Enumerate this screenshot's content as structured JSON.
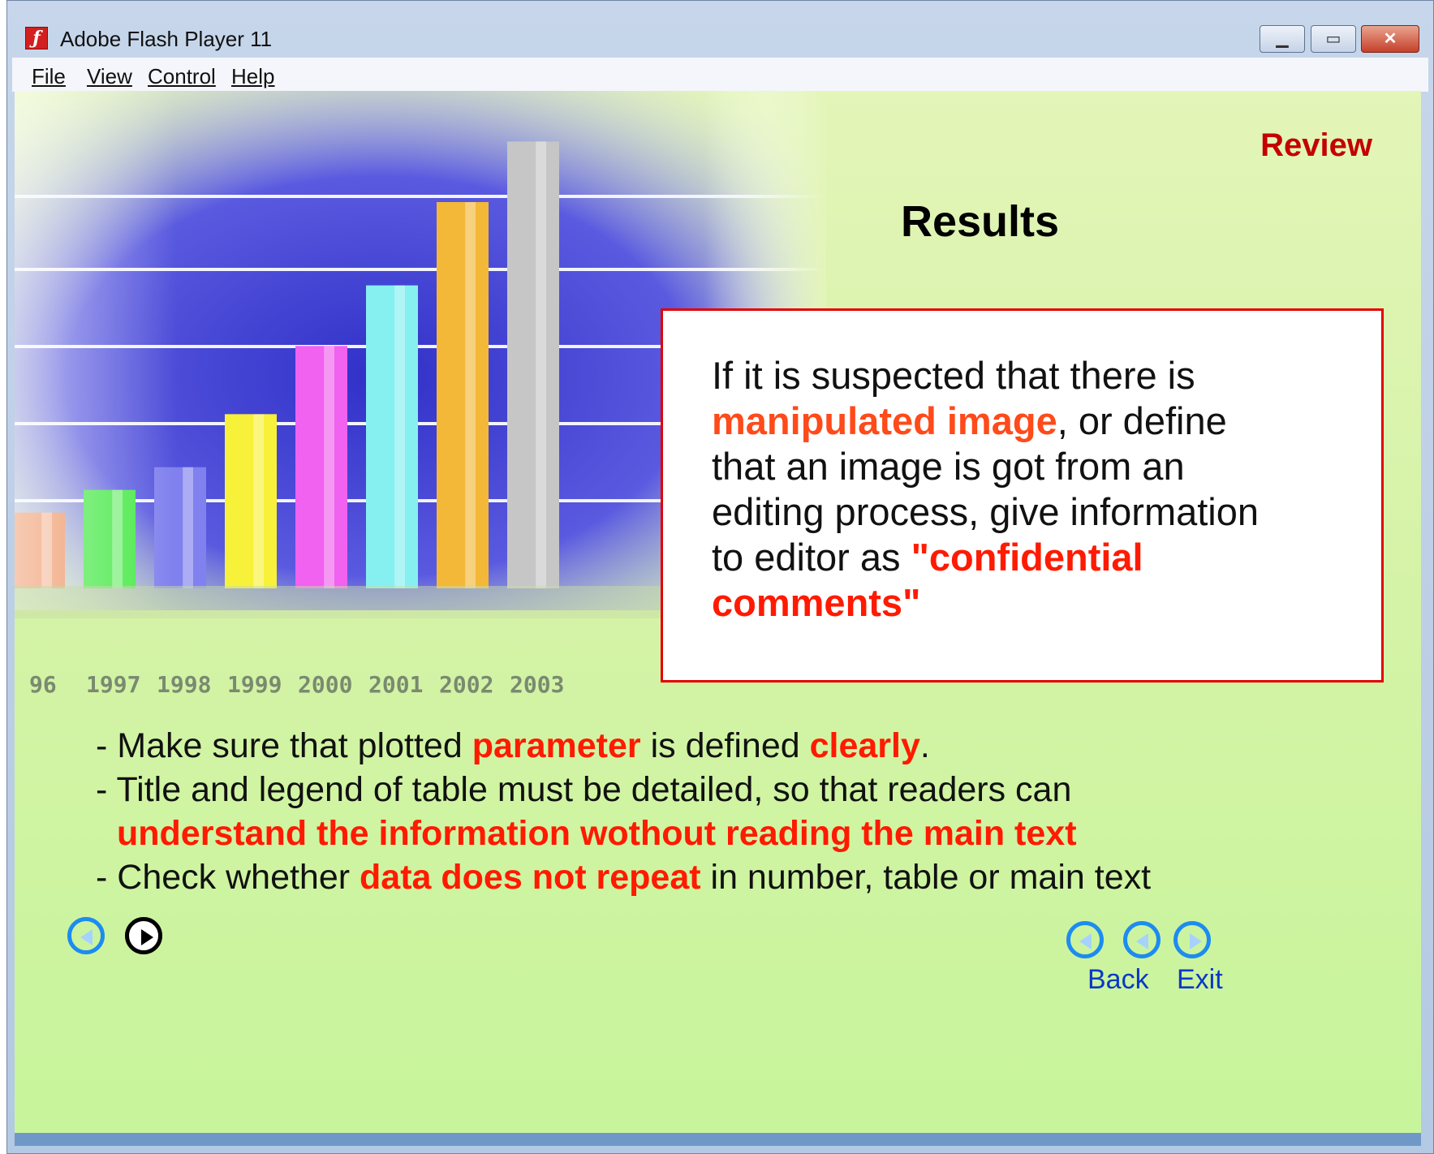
{
  "window": {
    "title": "Adobe Flash Player 11"
  },
  "menu": {
    "file": "File",
    "view": "View",
    "control": "Control",
    "help": "Help"
  },
  "chart_data": {
    "type": "bar",
    "categories": [
      "96",
      "1997",
      "1998",
      "1999",
      "2000",
      "2001",
      "2002",
      "2003"
    ],
    "values": [
      1.0,
      1.3,
      1.6,
      2.3,
      3.2,
      4.0,
      5.1,
      5.9
    ],
    "colors": [
      "#ec8a55",
      "#44e844",
      "#8080ee",
      "#f7f13a",
      "#f062ef",
      "#86f0f0",
      "#f3b838",
      "#c6c6c6"
    ]
  },
  "slide": {
    "section": "Review",
    "title": "Results",
    "callout": {
      "t1": "If it is suspected that there is",
      "t2": "manipulated image",
      "t3": ", or define",
      "t4": "that an image is got from an",
      "t5": "editing process, give information",
      "t6": "to editor as ",
      "t7": "\"confidential",
      "t8": "comments\""
    },
    "bullets": {
      "b1a": "- Make sure that plotted ",
      "b1b": "parameter",
      "b1c": " is defined ",
      "b1d": "clearly",
      "b1e": ".",
      "b2a": "- Title and legend of table must be detailed, so that readers can",
      "b2b": "understand the information wothout reading the main text",
      "b3a": "- Check whether ",
      "b3b": "data does not repeat",
      "b3c": " in number, table or main text"
    }
  },
  "nav": {
    "back": "Back",
    "exit": "Exit"
  }
}
